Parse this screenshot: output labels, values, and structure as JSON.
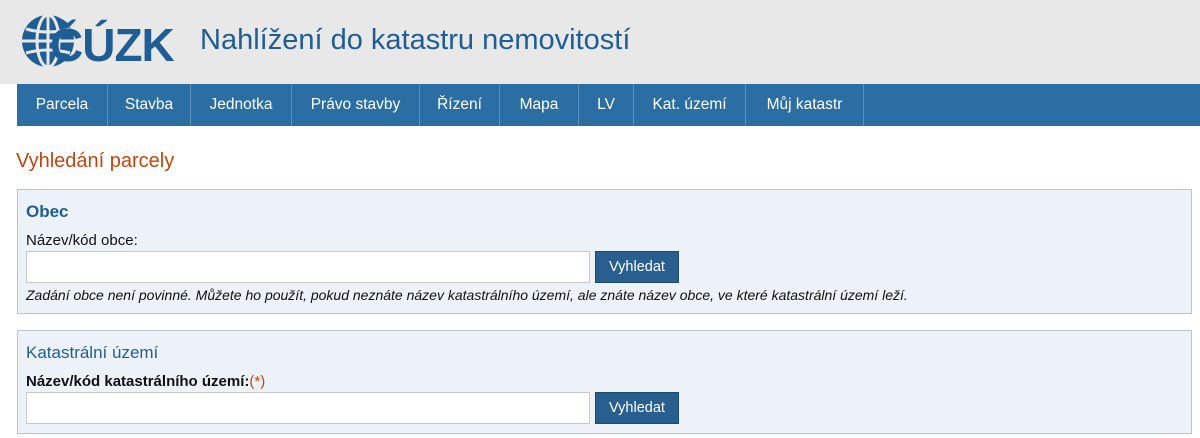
{
  "header": {
    "logo_text": "ČÚZK",
    "title": "Nahlížení do katastru nemovitostí"
  },
  "nav": {
    "items": [
      {
        "label": "Parcela"
      },
      {
        "label": "Stavba"
      },
      {
        "label": "Jednotka"
      },
      {
        "label": "Právo stavby"
      },
      {
        "label": "Řízení"
      },
      {
        "label": "Mapa"
      },
      {
        "label": "LV"
      },
      {
        "label": "Kat. území"
      },
      {
        "label": "Můj katastr"
      }
    ]
  },
  "page": {
    "title": "Vyhledání parcely"
  },
  "obec": {
    "heading": "Obec",
    "label": "Název/kód obce:",
    "value": "",
    "button": "Vyhledat",
    "hint": "Zadání obce není povinné. Můžete ho použít, pokud neznáte název katastrálního území, ale znáte název obce, ve které katastrální území leží."
  },
  "katastralni_uzemi": {
    "heading": "Katastrální území",
    "label": "Název/kód katastrálního území:",
    "required_mark": "(*)",
    "value": "",
    "button": "Vyhledat"
  },
  "colors": {
    "brand_blue": "#1f5e94",
    "nav_blue": "#2b6ea3",
    "accent_orange": "#c0460e",
    "panel_bg": "#edf2f8"
  }
}
